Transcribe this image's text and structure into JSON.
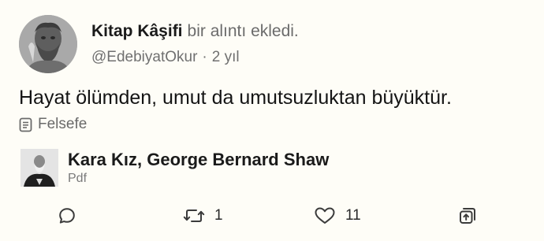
{
  "post": {
    "author_name": "Kitap Kâşifi",
    "action_text": "bir alıntı ekledi.",
    "handle": "@EdebiyatOkur",
    "separator": "·",
    "time_ago": "2 yıl",
    "quote": "Hayat ölümden, umut da umutsuzluktan büyüktür.",
    "tag": "Felsefe",
    "tag_icon": "document-list-icon",
    "avatar_icon": "statue-bust-avatar"
  },
  "book": {
    "title": "Kara Kız, George Bernard Shaw",
    "format": "Pdf",
    "cover_icon": "author-portrait"
  },
  "actions": {
    "comment_icon": "comment-bubble-icon",
    "repost_icon": "repost-icon",
    "repost_count": "1",
    "like_icon": "heart-icon",
    "like_count": "11",
    "share_icon": "share-icon"
  },
  "colors": {
    "background": "#fefdf7",
    "text_primary": "#111111",
    "text_secondary": "#707070"
  }
}
